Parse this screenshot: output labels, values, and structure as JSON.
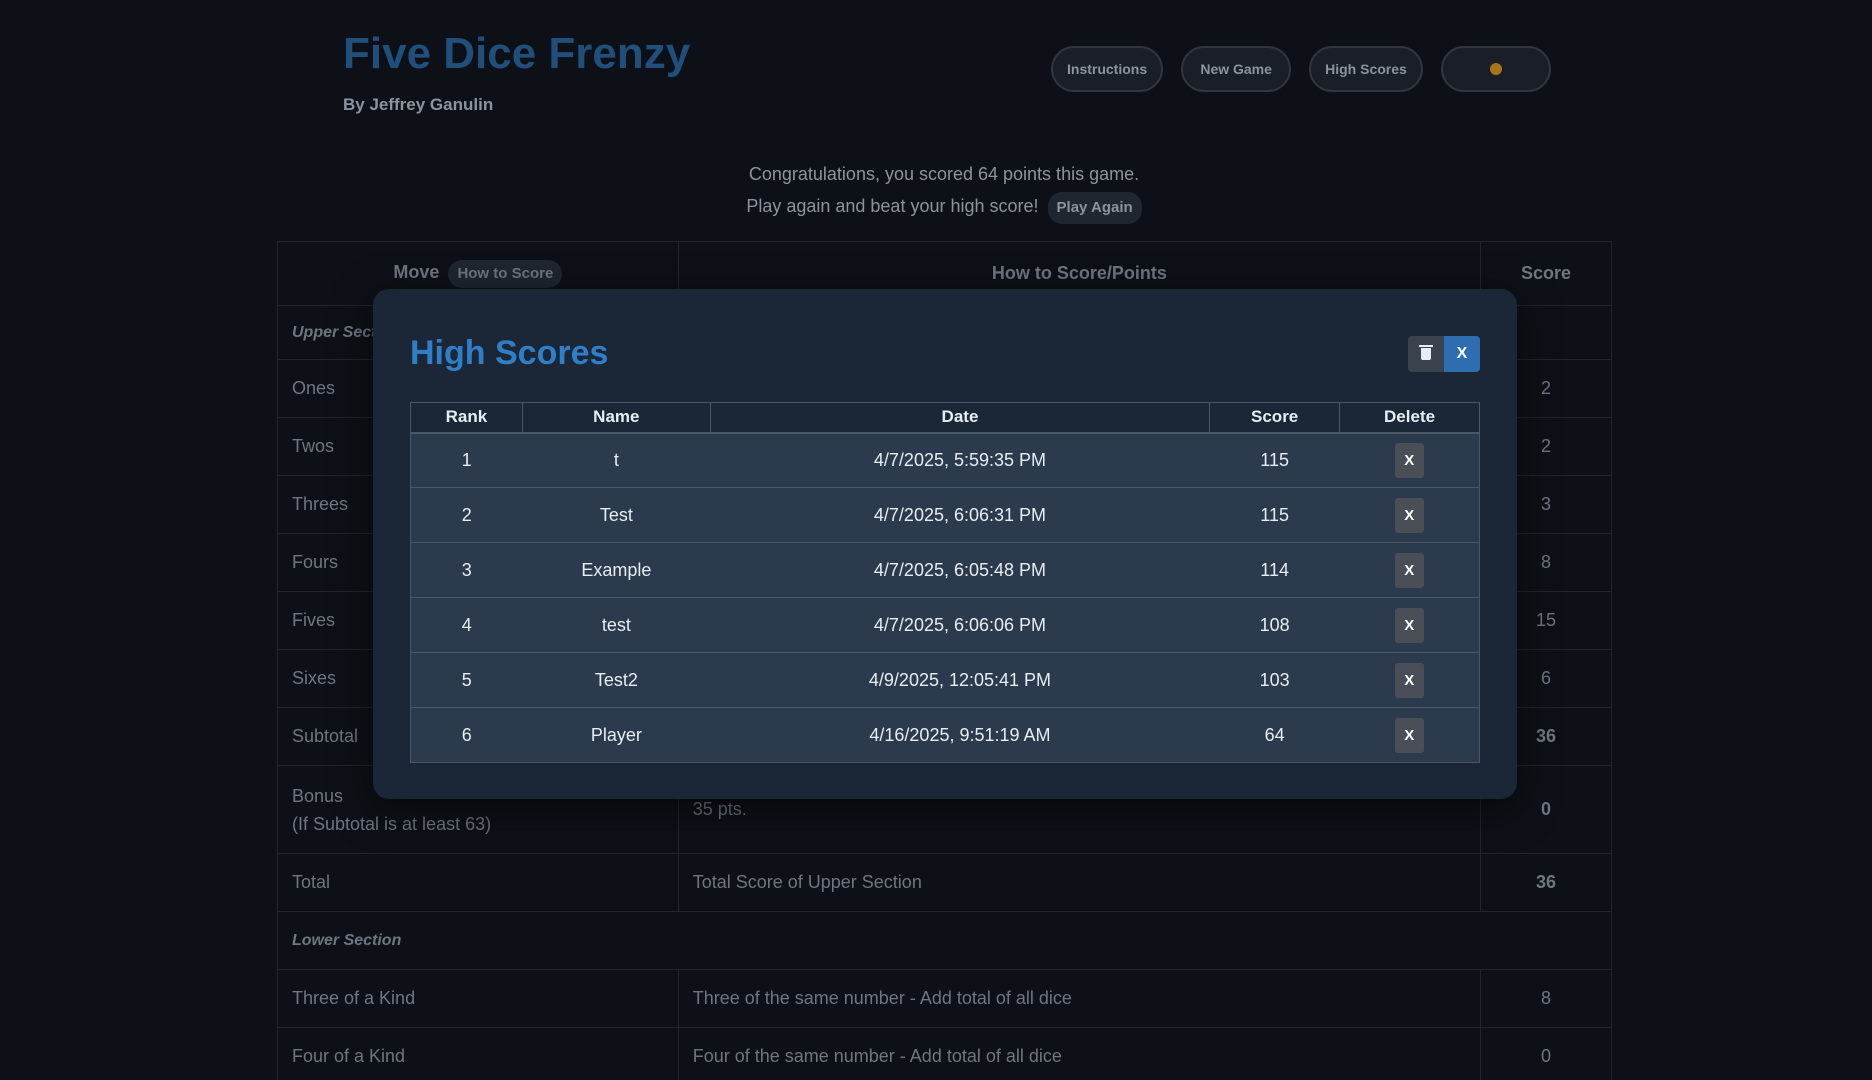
{
  "header": {
    "title": "Five Dice Frenzy",
    "author": "By Jeffrey Ganulin"
  },
  "nav": {
    "instructions": "Instructions",
    "new_game": "New Game",
    "high_scores": "High Scores",
    "theme_icon": "sun-icon"
  },
  "congrats": {
    "line1": "Congratulations, you scored 64 points this game.",
    "line2": "Play again and beat your high score!",
    "play_again": "Play Again"
  },
  "score_table": {
    "headers": {
      "move": "Move",
      "how_to_score_btn": "How to Score",
      "how": "How to Score/Points",
      "score": "Score"
    },
    "upper_section": "Upper Section",
    "rows": [
      {
        "move": "Ones",
        "score": "2"
      },
      {
        "move": "Twos",
        "score": "2"
      },
      {
        "move": "Threes",
        "score": "3"
      },
      {
        "move": "Fours",
        "score": "8"
      },
      {
        "move": "Fives",
        "score": "15"
      },
      {
        "move": "Sixes",
        "score": "6"
      },
      {
        "move": "Subtotal",
        "score": "36"
      }
    ],
    "bonus": {
      "move_line1": "Bonus",
      "move_line2": "(If Subtotal is at least 63)",
      "how": "35 pts.",
      "score": "0"
    },
    "total": {
      "move": "Total",
      "how": "Total Score of Upper Section",
      "score": "36"
    },
    "lower_section": "Lower Section",
    "lower_rows": [
      {
        "move": "Three of a Kind",
        "how": "Three of the same number - Add total of all dice",
        "score": "8"
      },
      {
        "move": "Four of a Kind",
        "how": "Four of the same number - Add total of all dice",
        "score": "0"
      }
    ]
  },
  "modal": {
    "title": "High Scores",
    "close_label": "X",
    "columns": [
      "Rank",
      "Name",
      "Date",
      "Score",
      "Delete"
    ],
    "delete_label": "X",
    "rows": [
      {
        "rank": "1",
        "name": "t",
        "date": "4/7/2025, 5:59:35 PM",
        "score": "115"
      },
      {
        "rank": "2",
        "name": "Test",
        "date": "4/7/2025, 6:06:31 PM",
        "score": "115"
      },
      {
        "rank": "3",
        "name": "Example",
        "date": "4/7/2025, 6:05:48 PM",
        "score": "114"
      },
      {
        "rank": "4",
        "name": "test",
        "date": "4/7/2025, 6:06:06 PM",
        "score": "108"
      },
      {
        "rank": "5",
        "name": "Test2",
        "date": "4/9/2025, 12:05:41 PM",
        "score": "103"
      },
      {
        "rank": "6",
        "name": "Player",
        "date": "4/16/2025, 9:51:19 AM",
        "score": "64"
      }
    ]
  },
  "colors": {
    "background": "#0d1117",
    "modal_bg": "#1b2736",
    "accent_blue": "#2f7fc8",
    "row_bg": "#2b3b4d"
  }
}
